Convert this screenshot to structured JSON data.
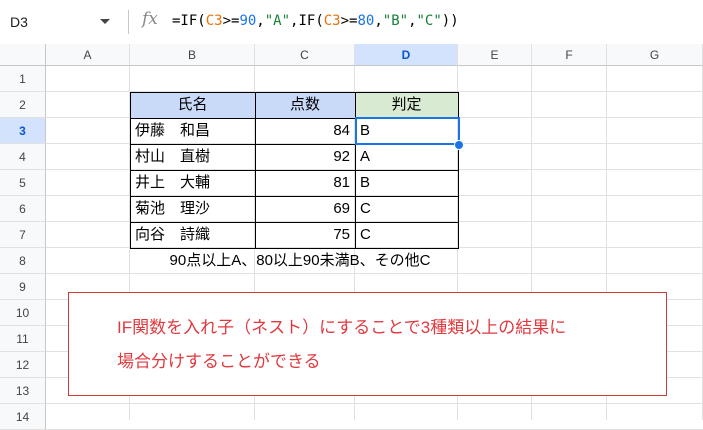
{
  "formula_bar": {
    "cell_ref": "D3",
    "fx_label": "fx",
    "formula_parts": [
      {
        "t": "=IF(",
        "c": "plain"
      },
      {
        "t": "C3",
        "c": "ref"
      },
      {
        "t": ">=",
        "c": "plain"
      },
      {
        "t": "90",
        "c": "num"
      },
      {
        "t": ",",
        "c": "plain"
      },
      {
        "t": "\"A\"",
        "c": "str"
      },
      {
        "t": ",IF(",
        "c": "plain"
      },
      {
        "t": "C3",
        "c": "ref"
      },
      {
        "t": ">=",
        "c": "plain"
      },
      {
        "t": "80",
        "c": "num"
      },
      {
        "t": ",",
        "c": "plain"
      },
      {
        "t": "\"B\"",
        "c": "str"
      },
      {
        "t": ",",
        "c": "plain"
      },
      {
        "t": "\"C\"",
        "c": "str"
      },
      {
        "t": "))",
        "c": "plain"
      }
    ]
  },
  "columns": [
    "A",
    "B",
    "C",
    "D",
    "E",
    "F",
    "G"
  ],
  "selected_column": "D",
  "rows": [
    "1",
    "2",
    "3",
    "4",
    "5",
    "6",
    "7",
    "8",
    "9",
    "10",
    "11",
    "12",
    "13",
    "14"
  ],
  "selected_row": "3",
  "table": {
    "headers": {
      "name": "氏名",
      "score": "点数",
      "grade": "判定"
    },
    "records": [
      {
        "name": "伊藤　和昌",
        "score": "84",
        "grade": "B"
      },
      {
        "name": "村山　直樹",
        "score": "92",
        "grade": "A"
      },
      {
        "name": "井上　大輔",
        "score": "81",
        "grade": "B"
      },
      {
        "name": "菊池　理沙",
        "score": "69",
        "grade": "C"
      },
      {
        "name": "向谷　詩織",
        "score": "75",
        "grade": "C"
      }
    ]
  },
  "note": "90点以上A、80以上90未満B、その他C",
  "callout": {
    "line1": "IF関数を入れ子（ネスト）にすることで3種類以上の結果に",
    "line2": "場合分けすることができる"
  },
  "colors": {
    "header_blue": "#c9daf8",
    "header_green": "#d9ead3",
    "selection": "#1a73e8",
    "callout_text": "#e0393e"
  }
}
